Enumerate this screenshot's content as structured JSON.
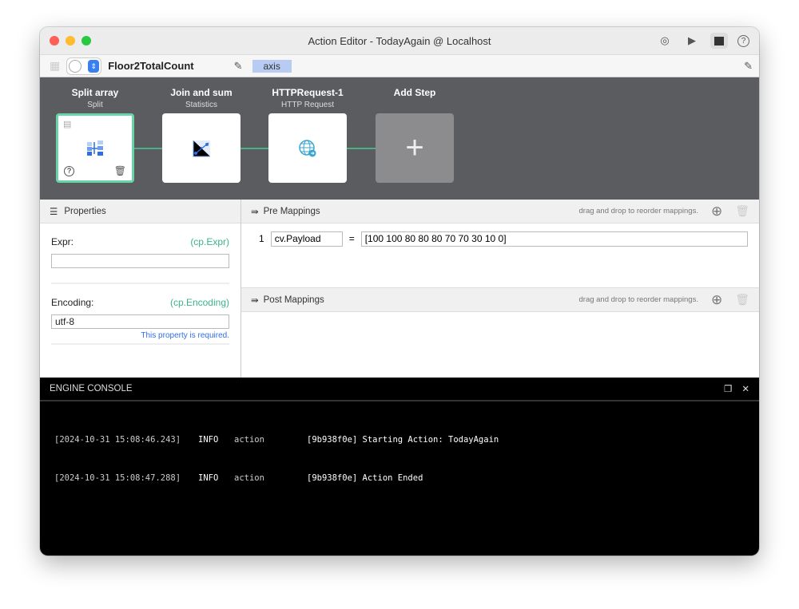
{
  "window": {
    "title": "Action Editor - TodayAgain @ Localhost"
  },
  "toolbar": {
    "action_name": "Floor2TotalCount",
    "tag": "axis"
  },
  "pipeline": {
    "steps": [
      {
        "title": "Split array",
        "subtitle": "Split",
        "icon": "split-icon"
      },
      {
        "title": "Join and sum",
        "subtitle": "Statistics",
        "icon": "chart-icon"
      },
      {
        "title": "HTTPRequest-1",
        "subtitle": "HTTP Request",
        "icon": "globe-icon"
      },
      {
        "title": "Add Step",
        "subtitle": "",
        "icon": "plus-icon"
      }
    ]
  },
  "properties": {
    "title": "Properties",
    "fields": [
      {
        "label": "Expr:",
        "key": "(cp.Expr)",
        "value": ""
      },
      {
        "label": "Encoding:",
        "key": "(cp.Encoding)",
        "value": "utf-8",
        "note": "This property is required."
      }
    ]
  },
  "pre_mappings": {
    "title": "Pre Mappings",
    "hint": "drag and drop to reorder mappings.",
    "rows": [
      {
        "index": "1",
        "target": "cv.Payload",
        "op": "=",
        "value": "[100 100 80 80 80 70 70 30 10 0]"
      }
    ]
  },
  "post_mappings": {
    "title": "Post Mappings",
    "hint": "drag and drop to reorder mappings."
  },
  "console": {
    "title": "ENGINE CONSOLE",
    "lines": [
      {
        "ts": "[2024-10-31 15:08:46.243]",
        "level": "INFO",
        "source": "action",
        "msg": "[9b938f0e] Starting Action: TodayAgain"
      },
      {
        "ts": "[2024-10-31 15:08:47.288]",
        "level": "INFO",
        "source": "action",
        "msg": "[9b938f0e] Action Ended"
      }
    ]
  }
}
